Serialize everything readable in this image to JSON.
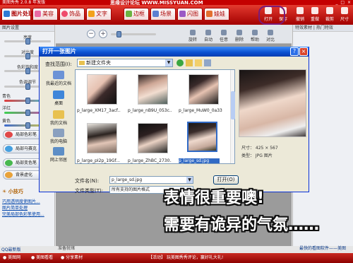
{
  "window": {
    "title": "美图秀秀 2.0.8 年发版",
    "watermark": "思缘设计论坛  WWW.MISSYUAN.COM",
    "controls": "_ □ ×"
  },
  "tabs": [
    {
      "label": "图片处理",
      "active": true
    },
    {
      "label": "美容"
    },
    {
      "label": "饰品"
    },
    {
      "label": "文字"
    },
    {
      "label": "边框"
    },
    {
      "label": "场景"
    },
    {
      "label": "闪图"
    },
    {
      "label": "娃娃"
    }
  ],
  "toolbar_right": [
    {
      "label": "打开",
      "icon": "folder-open-icon"
    },
    {
      "label": "保存",
      "icon": "save-icon"
    },
    {
      "label": "撤销",
      "icon": "undo-icon"
    },
    {
      "label": "重做",
      "icon": "redo-icon"
    },
    {
      "label": "裁剪",
      "icon": "crop-icon"
    },
    {
      "label": "尺寸",
      "icon": "resize-icon"
    }
  ],
  "left_panel": {
    "header": "图片设置",
    "sliders": [
      {
        "label": "亮度",
        "value": 0.5
      },
      {
        "label": "对比度",
        "value": 0.5
      },
      {
        "label": "色彩饱和度",
        "value": 0.5
      },
      {
        "label": "色调调节",
        "value": 0.5
      },
      {
        "label": "青色",
        "value": 0.5
      },
      {
        "label": "洋红",
        "value": 0.5
      },
      {
        "label": "黄色",
        "value": 0.5
      }
    ],
    "buttons": [
      "局部色彩笔",
      "局部马赛克",
      "局部变色笔",
      "背景虚化"
    ],
    "tips_title": "小技巧",
    "tip_links": [
      "巧用透明度使图片...",
      "图片简单处理",
      "完美局部色彩笔使用..."
    ],
    "footer": "QQ最新版"
  },
  "zoom_bar": {
    "buttons": [
      "旋转",
      "自动",
      "任意",
      "删除",
      "帮助",
      "对比"
    ]
  },
  "canvas_bottom_label": "准备就绪",
  "right_panel": {
    "header": "特效素材 | 热门特效",
    "footer": "最快的看图软件——美图"
  },
  "status_bar": {
    "left_items": [
      "美图网",
      "美图看看",
      "分享素材"
    ],
    "promo": "【活动】 玩美图秀秀评论，赢好礼大礼!"
  },
  "dialog": {
    "title": "打开一张图片",
    "look_in_label": "查找范围(I):",
    "look_in_value": "新建文件夹",
    "places": [
      {
        "label": "我最近的文档",
        "icon": "recent-docs-icon"
      },
      {
        "label": "桌面",
        "icon": "desktop-icon"
      },
      {
        "label": "我的文档",
        "icon": "my-documents-icon"
      },
      {
        "label": "我的电脑",
        "icon": "my-computer-icon"
      },
      {
        "label": "网上邻居",
        "icon": "network-icon"
      }
    ],
    "files": [
      {
        "name": "p_large_XM17_3acf...",
        "selected": false
      },
      {
        "name": "p_large_nB9U_053c...",
        "selected": false
      },
      {
        "name": "p_large_MuW0_0a33...",
        "selected": false
      },
      {
        "name": "p_large_pI2p_19Gf...",
        "selected": false
      },
      {
        "name": "p_large_ZhBC_2730...",
        "selected": false
      },
      {
        "name": "p_large_sd.jpg",
        "selected": true
      }
    ],
    "preview_size": "尺寸：  425 × 567",
    "preview_type": "类型：  JPG 图片",
    "filename_label": "文件名(N):",
    "filename_value": "p_large_sd.jpg",
    "filetype_label": "文件类型(T):",
    "filetype_value": "所有支持的图片格式",
    "open_button": "打开(O)",
    "cancel_button": "取消"
  },
  "overlay": {
    "line1": "表情很重要噢!",
    "line2": "需要有诡异的气氛……"
  },
  "colors": {
    "title_red": "#c40000",
    "dialog_blue": "#0a4fd0",
    "selection_blue": "#316ac5",
    "annotation_circle": "#7a1a7a"
  }
}
